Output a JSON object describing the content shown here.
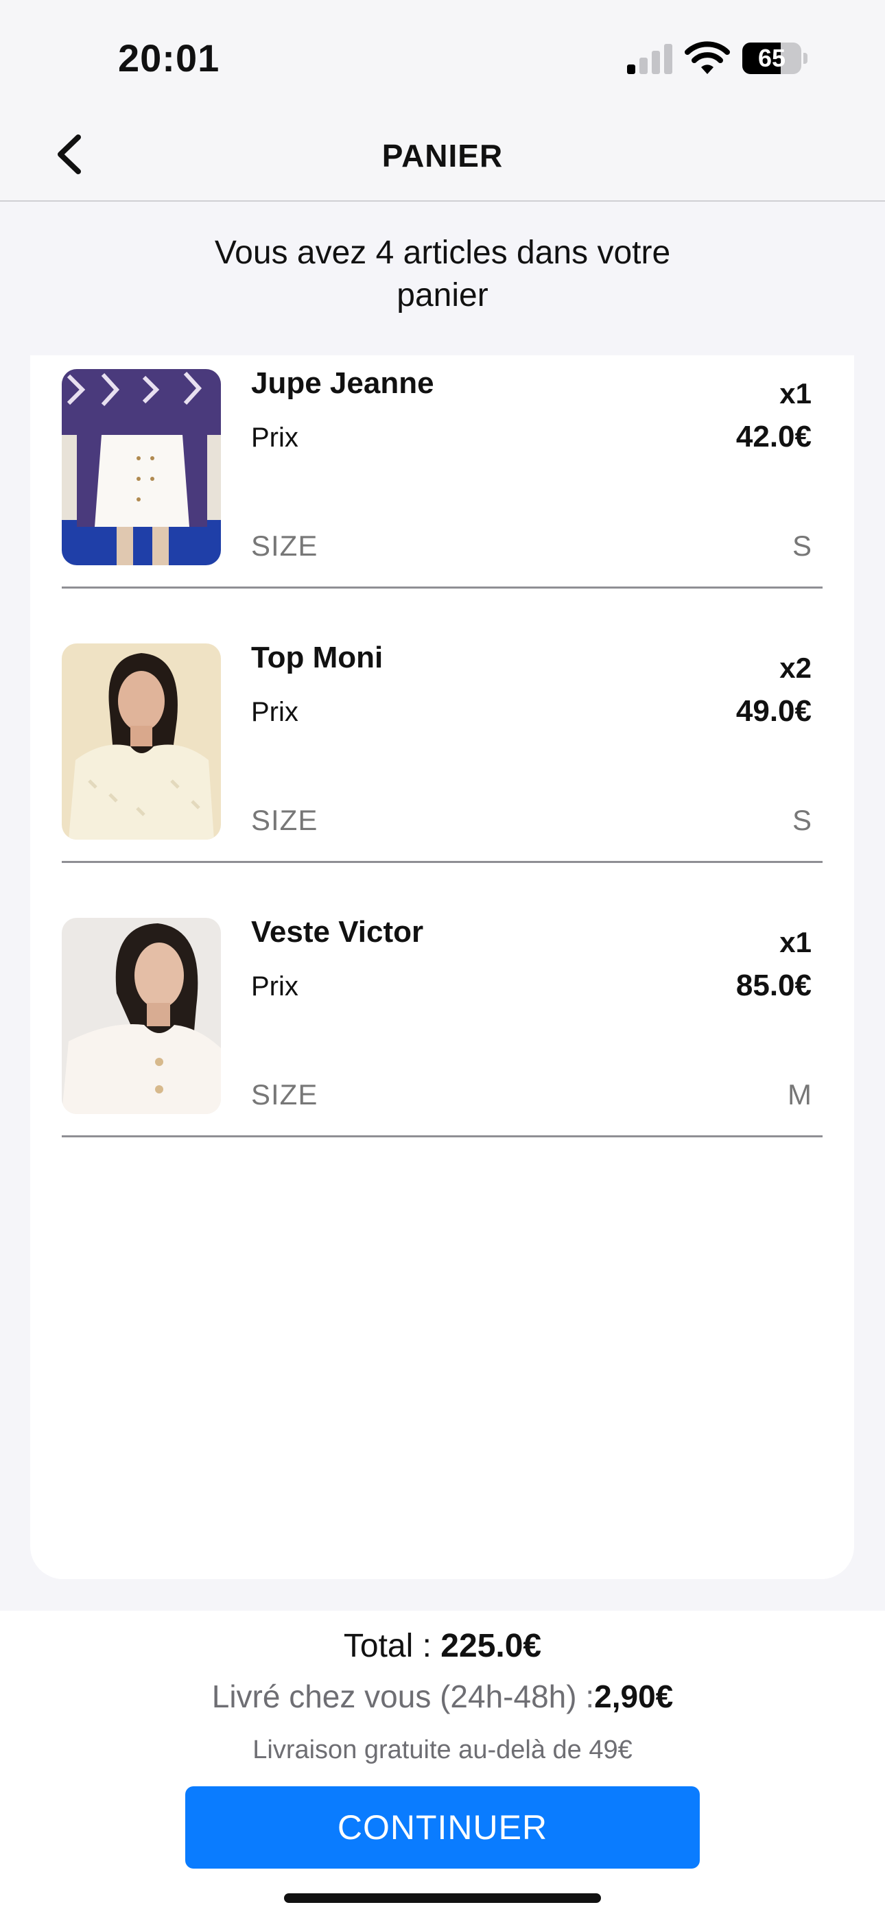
{
  "status_bar": {
    "time": "20:01",
    "battery_level": "65",
    "battery_fraction": 0.65
  },
  "nav": {
    "title": "PANIER",
    "back_icon": "chevron-left-icon"
  },
  "summary": {
    "text": "Vous avez 4 articles dans votre panier"
  },
  "cart_items": [
    {
      "name": "Jupe Jeanne",
      "quantity": "x1",
      "price_label": "Prix",
      "price": "42.0€",
      "size_label": "SIZE",
      "size": "S"
    },
    {
      "name": "Top Moni",
      "quantity": "x2",
      "price_label": "Prix",
      "price": "49.0€",
      "size_label": "SIZE",
      "size": "S"
    },
    {
      "name": "Veste Victor",
      "quantity": "x1",
      "price_label": "Prix",
      "price": "85.0€",
      "size_label": "SIZE",
      "size": "M"
    }
  ],
  "footer": {
    "total_label": "Total : ",
    "total_value": "225.0€",
    "delivery_label": "Livré chez vous (24h-48h) :",
    "delivery_value": "2,90€",
    "free_shipping": "Livraison gratuite au-delà de 49€",
    "continue_label": "CONTINUER"
  },
  "colors": {
    "accent": "#0a7cff",
    "background": "#f5f5f9",
    "card": "#ffffff"
  }
}
